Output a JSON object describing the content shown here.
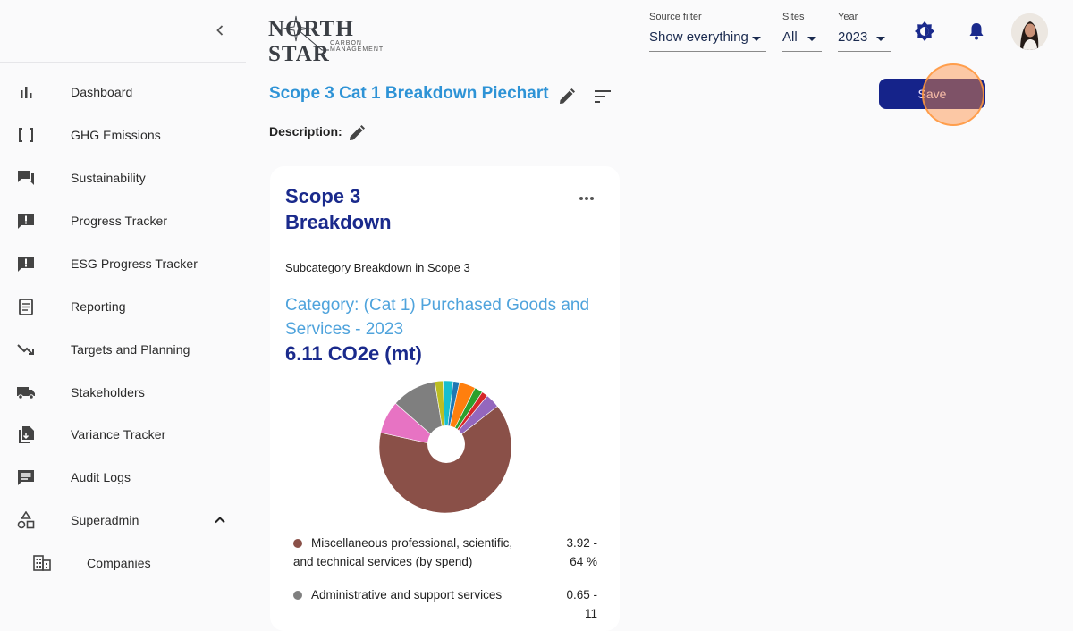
{
  "logo": {
    "title": "NORTH STAR",
    "subtitle": "CARBON MANAGEMENT"
  },
  "filters": {
    "source": {
      "label": "Source filter",
      "value": "Show everything"
    },
    "sites": {
      "label": "Sites",
      "value": "All"
    },
    "year": {
      "label": "Year",
      "value": "2023"
    }
  },
  "sidebar": {
    "items": [
      {
        "label": "Dashboard",
        "icon": "bar-chart-icon"
      },
      {
        "label": "GHG Emissions",
        "icon": "brackets-icon"
      },
      {
        "label": "Sustainability",
        "icon": "forum-icon"
      },
      {
        "label": "Progress Tracker",
        "icon": "feedback-icon"
      },
      {
        "label": "ESG Progress Tracker",
        "icon": "feedback-icon"
      },
      {
        "label": "Reporting",
        "icon": "document-icon"
      },
      {
        "label": "Targets and Planning",
        "icon": "trending-down-icon"
      },
      {
        "label": "Stakeholders",
        "icon": "truck-icon"
      },
      {
        "label": "Variance Tracker",
        "icon": "file-copy-icon"
      },
      {
        "label": "Audit Logs",
        "icon": "message-icon"
      },
      {
        "label": "Superadmin",
        "icon": "shapes-icon"
      },
      {
        "label": "Companies",
        "icon": "building-icon"
      }
    ]
  },
  "page": {
    "title": "Scope 3 Cat 1 Breakdown Piechart",
    "description_label": "Description:",
    "save_label": "Save"
  },
  "card": {
    "title": "Scope 3 Breakdown",
    "subtitle": "Subcategory Breakdown in Scope 3",
    "category": "Category: (Cat 1) Purchased Goods and Services - 2023",
    "total": "6.11 CO2e (mt)",
    "legend": [
      {
        "name": "Miscellaneous professional, scientific, and technical services (by spend)",
        "value": "3.92 - 64 %",
        "color": "#8a5048"
      },
      {
        "name": "Administrative and support services",
        "value": "0.65 - 11",
        "color": "#7f7f7f"
      }
    ]
  },
  "chart_data": {
    "type": "pie",
    "title": "",
    "slices": [
      {
        "label": "Miscellaneous professional, scientific, and technical services (by spend)",
        "value": 64,
        "color": "#8a5048"
      },
      {
        "label": "",
        "value": 8,
        "color": "#e773c3"
      },
      {
        "label": "Administrative and support services",
        "value": 11,
        "color": "#7f7f7f"
      },
      {
        "label": "",
        "value": 2,
        "color": "#bcbd22"
      },
      {
        "label": "",
        "value": 2.5,
        "color": "#17becf"
      },
      {
        "label": "",
        "value": 1.5,
        "color": "#1f77b4"
      },
      {
        "label": "",
        "value": 4,
        "color": "#ff7f0e"
      },
      {
        "label": "",
        "value": 2,
        "color": "#2ca02c"
      },
      {
        "label": "",
        "value": 1.5,
        "color": "#d62728"
      },
      {
        "label": "",
        "value": 3.5,
        "color": "#9467bd"
      }
    ]
  }
}
